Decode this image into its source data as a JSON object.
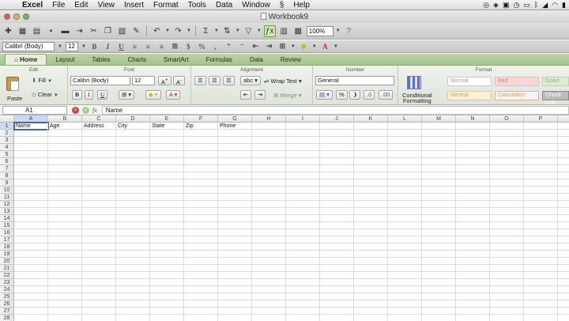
{
  "menubar": {
    "app": "Excel",
    "items": [
      "File",
      "Edit",
      "View",
      "Insert",
      "Format",
      "Tools",
      "Data",
      "Window",
      "Help"
    ]
  },
  "window": {
    "title": "Workbook9"
  },
  "toolbar": {
    "zoom": "100%"
  },
  "format_bar": {
    "font": "Calibri (Body)",
    "size": "12"
  },
  "ribbon": {
    "tabs": [
      "Home",
      "Layout",
      "Tables",
      "Charts",
      "SmartArt",
      "Formulas",
      "Data",
      "Review"
    ],
    "active_tab": "Home",
    "groups": {
      "edit": "Edit",
      "font": "Font",
      "alignment": "Alignment",
      "number": "Number",
      "format": "Format"
    },
    "edit": {
      "paste": "Paste",
      "fill": "Fill",
      "clear": "Clear"
    },
    "font": {
      "name": "Calibri (Body)",
      "size": "12"
    },
    "alignment": {
      "wrap_text": "Wrap Text",
      "merge": "Merge",
      "abc": "abc"
    },
    "number": {
      "format": "General"
    },
    "format": {
      "conditional_formatting_line1": "Conditional",
      "conditional_formatting_line2": "Formatting",
      "styles": [
        "Normal",
        "Bad",
        "Good",
        "Neutral",
        "Calculation",
        "Check Cell"
      ]
    }
  },
  "formula_bar": {
    "cell_ref": "A1",
    "content": "Name"
  },
  "sheet": {
    "columns": [
      "A",
      "B",
      "C",
      "D",
      "E",
      "F",
      "G",
      "H",
      "I",
      "J",
      "K",
      "L",
      "M",
      "N",
      "O",
      "P"
    ],
    "rows": [
      "1",
      "2",
      "3",
      "4",
      "5",
      "6",
      "7",
      "8",
      "9",
      "10",
      "11",
      "12",
      "13",
      "14",
      "15",
      "16",
      "17",
      "18",
      "19",
      "20",
      "21",
      "22",
      "23",
      "24",
      "25",
      "26",
      "27",
      "28"
    ],
    "headers": [
      "Name",
      "Age",
      "Address",
      "City",
      "State",
      "Zip",
      "Phone"
    ],
    "active_cell": "A1"
  }
}
